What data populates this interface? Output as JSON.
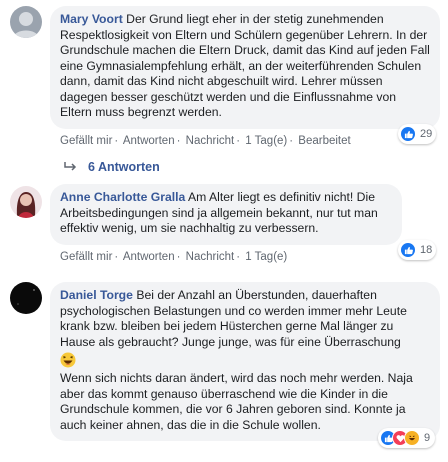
{
  "comments": [
    {
      "author": "Mary Voort",
      "text": "Der Grund liegt eher in der stetig zunehmenden Respektlosigkeit von Eltern und Schülern gegenüber Lehrern. In der Grundschule machen die Eltern Druck, damit das Kind auf jeden Fall eine Gymnasialempfehlung erhält, an der weiterführenden Schulen dann, damit das Kind nicht abgeschuilt wird. Lehrer müssen dagegen besser geschützt werden und die Einflussnahme von Eltern muss begrenzt werden.",
      "like": "Gefällt mir",
      "reply": "Antworten",
      "message": "Nachricht",
      "time": "1 Tag(e)",
      "edited": "Bearbeitet",
      "reaction_count": "29"
    },
    {
      "author": "Anne Charlotte Gralla",
      "text": "Am Alter liegt es definitiv nicht! Die Arbeitsbedingungen sind ja allgemein bekannt, nur tut man effektiv wenig, um sie nachhaltig zu verbessern.",
      "like": "Gefällt mir",
      "reply": "Antworten",
      "message": "Nachricht",
      "time": "1 Tag(e)",
      "reaction_count": "18"
    },
    {
      "author": "Daniel Torge",
      "text": "Bei der Anzahl an Überstunden, dauerhaften psychologischen Belastungen und co werden immer mehr Leute krank bzw. bleiben bei jedem Hüsterchen gerne Mal länger zu Hause als gebraucht? Junge junge, was für eine Überraschung",
      "text2": "Wenn sich nichts daran ändert, wird das noch mehr werden. Naja aber das kommt genauso überraschend wie die Kinder in die Grundschule kommen, die vor 6 Jahren geboren sind. Konnte ja auch keiner ahnen, das die in die Schule wollen.",
      "reaction_count": "9"
    }
  ],
  "replies_link": "6 Antworten",
  "colors": {
    "name": "#385898",
    "bubble": "#f2f3f5",
    "like": "#1877f2",
    "love": "#f33e58",
    "haha": "#f7b125"
  },
  "icons": [
    "reply-arrow-icon",
    "like-reaction-icon",
    "love-reaction-icon",
    "haha-reaction-icon",
    "laughing-emoji-icon"
  ]
}
